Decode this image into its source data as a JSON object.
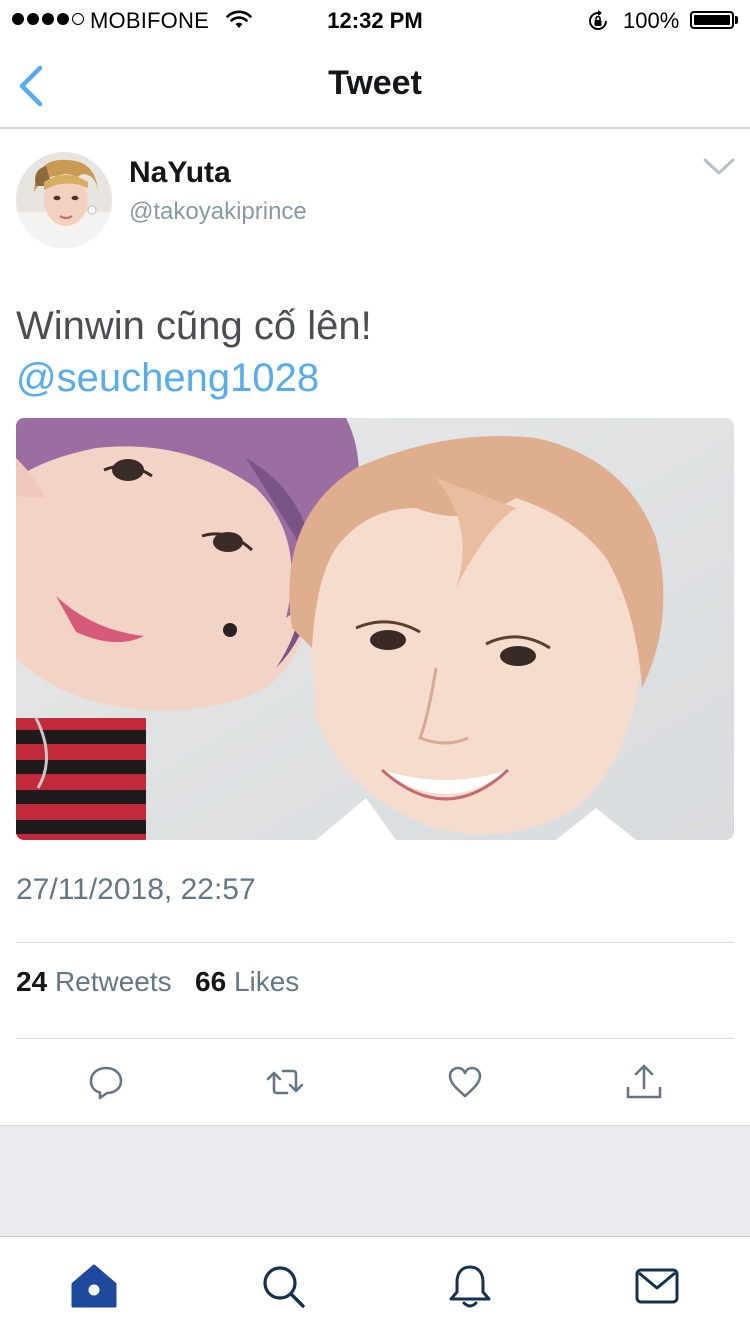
{
  "status_bar": {
    "carrier": "MOBIFONE",
    "time": "12:32 PM",
    "battery": "100%",
    "signal_bars": 4
  },
  "nav": {
    "title": "Tweet",
    "back_icon": "chevron-left-icon"
  },
  "tweet": {
    "author_name": "NaYuta",
    "author_handle": "@takoyakiprince",
    "text": "Winwin cũng cố lên!",
    "mention": "@seucheng1028",
    "timestamp": "27/11/2018, 22:57",
    "retweet_count": "24",
    "retweet_label": "Retweets",
    "like_count": "66",
    "like_label": "Likes"
  },
  "actions": [
    "reply-icon",
    "retweet-icon",
    "like-icon",
    "share-icon"
  ],
  "tabs": [
    "home-icon",
    "search-icon",
    "notifications-icon",
    "messages-icon"
  ],
  "colors": {
    "accent": "#55acee",
    "tab_active": "#1d4a9c",
    "icon_gray": "#657786"
  }
}
